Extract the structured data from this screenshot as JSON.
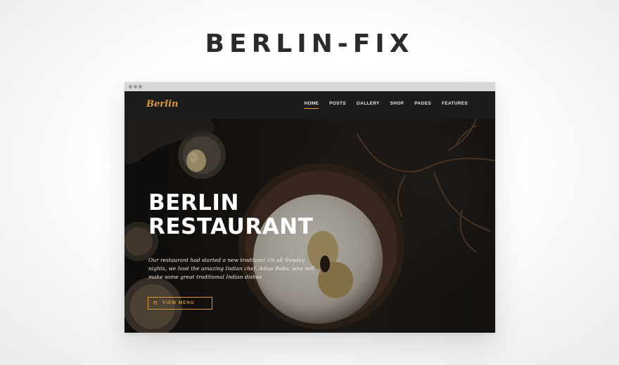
{
  "page": {
    "brand_title": "BERLIN-FIX"
  },
  "site": {
    "logo": "Berlin",
    "menu": [
      {
        "label": "HOME",
        "active": true
      },
      {
        "label": "POSTS",
        "active": false
      },
      {
        "label": "GALLERY",
        "active": false
      },
      {
        "label": "SHOP",
        "active": false
      },
      {
        "label": "PAGES",
        "active": false
      },
      {
        "label": "FEATURES",
        "active": false
      }
    ]
  },
  "hero": {
    "title_line1": "BERLIN",
    "title_line2": "RESTAURANT",
    "description": "Our restaurant had started a new tradition! On all Sunday nights, we host the amazing Indian chef, Adias Baba, who will make some great traditional Indian dishes",
    "cta_icon": "menu-book-icon",
    "cta_label": "VIEW MENU"
  },
  "colors": {
    "accent": "#d89a3a",
    "nav_bg": "#1c1c1c",
    "brand_title": "#2b2b2b"
  }
}
